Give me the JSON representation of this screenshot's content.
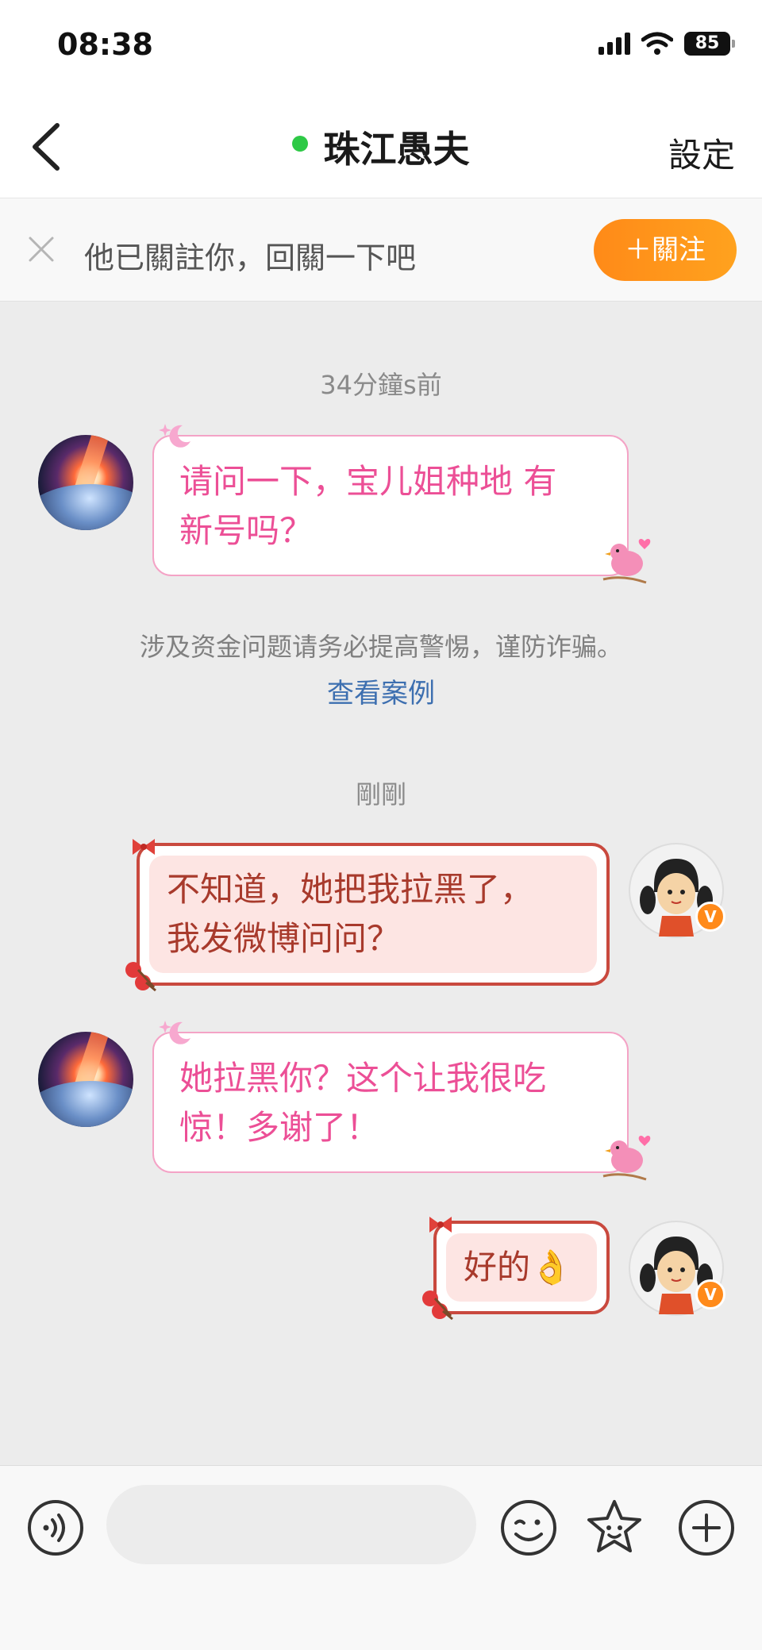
{
  "status_bar": {
    "time": "08:38",
    "battery": "85"
  },
  "header": {
    "title": "珠江愚夫",
    "settings_label": "設定"
  },
  "follow_banner": {
    "text": "他已關註你，回關一下吧",
    "button_label": "＋關注"
  },
  "messages": [
    {
      "type": "timestamp",
      "text": "34分鐘s前"
    },
    {
      "type": "incoming",
      "lines": [
        "请问一下，宝儿姐种地 有",
        "新号吗？"
      ]
    },
    {
      "type": "warning",
      "text": "涉及资金问题请务必提高警惕，谨防诈骗。",
      "link": "查看案例"
    },
    {
      "type": "timestamp",
      "text": "剛剛"
    },
    {
      "type": "outgoing",
      "lines": [
        "不知道，她把我拉黑了，",
        "我发微博问问？"
      ]
    },
    {
      "type": "incoming",
      "lines": [
        "她拉黑你？这个让我很吃",
        "惊！多谢了！"
      ]
    },
    {
      "type": "outgoing",
      "lines": [
        "好的👌"
      ]
    }
  ],
  "input_bar": {
    "placeholder": ""
  },
  "colors": {
    "accent_orange": "#ff8a18",
    "incoming_text": "#ec4f96",
    "outgoing_text": "#a83a2c",
    "link": "#3d6fb0",
    "online": "#2ec946"
  }
}
